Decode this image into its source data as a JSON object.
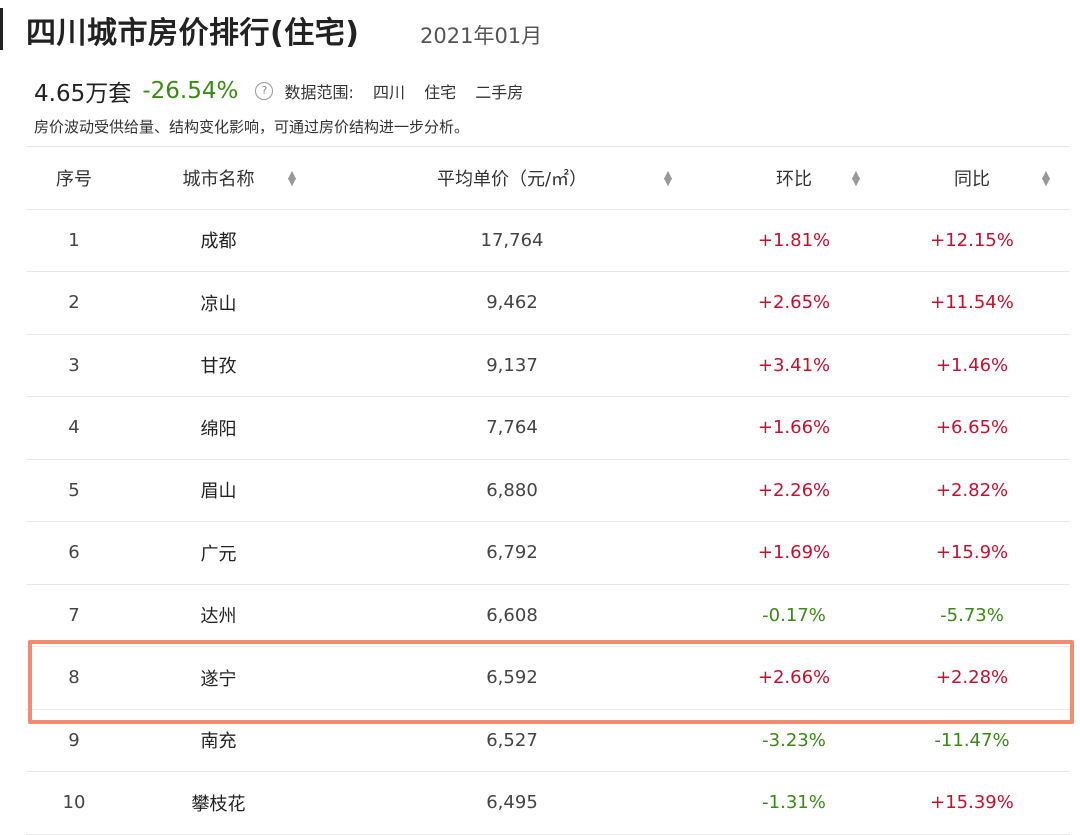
{
  "header": {
    "title": "四川城市房价排行(住宅)",
    "period": "2021年01月"
  },
  "summary": {
    "total": "4.65万套",
    "change": "-26.54%",
    "help_glyph": "?",
    "scope_label": "数据范围:",
    "scope_items": [
      "四川",
      "住宅",
      "二手房"
    ],
    "note": "房价波动受供给量、结构变化影响，可通过房价结构进一步分析。"
  },
  "table": {
    "columns": [
      "序号",
      "城市名称",
      "平均单价（元/㎡）",
      "环比",
      "同比"
    ],
    "rows": [
      {
        "rank": "1",
        "city": "成都",
        "price": "17,764",
        "mom": "+1.81%",
        "yoy": "+12.15%"
      },
      {
        "rank": "2",
        "city": "凉山",
        "price": "9,462",
        "mom": "+2.65%",
        "yoy": "+11.54%"
      },
      {
        "rank": "3",
        "city": "甘孜",
        "price": "9,137",
        "mom": "+3.41%",
        "yoy": "+1.46%"
      },
      {
        "rank": "4",
        "city": "绵阳",
        "price": "7,764",
        "mom": "+1.66%",
        "yoy": "+6.65%"
      },
      {
        "rank": "5",
        "city": "眉山",
        "price": "6,880",
        "mom": "+2.26%",
        "yoy": "+2.82%"
      },
      {
        "rank": "6",
        "city": "广元",
        "price": "6,792",
        "mom": "+1.69%",
        "yoy": "+15.9%"
      },
      {
        "rank": "7",
        "city": "达州",
        "price": "6,608",
        "mom": "-0.17%",
        "yoy": "-5.73%"
      },
      {
        "rank": "8",
        "city": "遂宁",
        "price": "6,592",
        "mom": "+2.66%",
        "yoy": "+2.28%"
      },
      {
        "rank": "9",
        "city": "南充",
        "price": "6,527",
        "mom": "-3.23%",
        "yoy": "-11.47%"
      },
      {
        "rank": "10",
        "city": "攀枝花",
        "price": "6,495",
        "mom": "-1.31%",
        "yoy": "+15.39%"
      }
    ]
  },
  "colors": {
    "increase": "#c8102e",
    "decrease": "#3a8a16",
    "highlight": "#f28b74"
  }
}
